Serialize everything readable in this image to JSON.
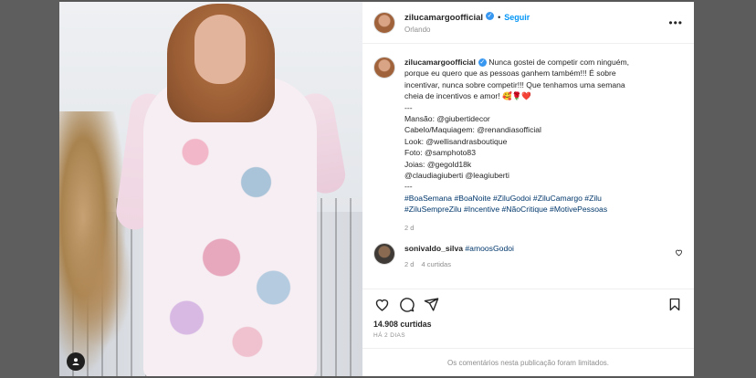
{
  "post": {
    "username": "zilucamargoofficial",
    "follow_label": "Seguir",
    "location": "Orlando",
    "caption_lines": [
      "Nunca gostei de competir com ninguém,",
      "porque eu quero que as pessoas ganhem também!!! É sobre",
      "incentivar, nunca sobre competir!!! Que tenhamos uma semana",
      "cheia de incentivos e amor! 🥰🌹❤️"
    ],
    "credits": [
      "---",
      "Mansão: @giubertidecor",
      "Cabelo/Maquiagem: @renandiasofficial",
      "Look: @wellisandrasboutique",
      "Foto: @samphoto83",
      "Joias: @gegold18k",
      "@claudiagiuberti @leagiuberti",
      "---"
    ],
    "hashtags_lines": [
      "#BoaSemana #BoaNoite #ZiluGodoi #ZiluCamargo #Zilu",
      "#ZiluSempreZilu #Incentive #NãoCritique #MotivePessoas"
    ],
    "caption_time": "2 d",
    "comment": {
      "username": "sonivaldo_silva",
      "text": "#amoosGodoi",
      "time": "2 d",
      "likes": "4 curtidas"
    },
    "likes_count": "14.908 curtidas",
    "posted_ago": "HÁ 2 DIAS",
    "comments_limited": "Os comentários nesta publicação foram limitados."
  },
  "icons": [
    "heart-icon",
    "comment-icon",
    "share-icon",
    "bookmark-icon",
    "more-icon",
    "verified-icon",
    "user-tag-icon"
  ],
  "colors": {
    "accent": "#0095f6",
    "overlay": "#575757",
    "verified": "#3897f0"
  }
}
